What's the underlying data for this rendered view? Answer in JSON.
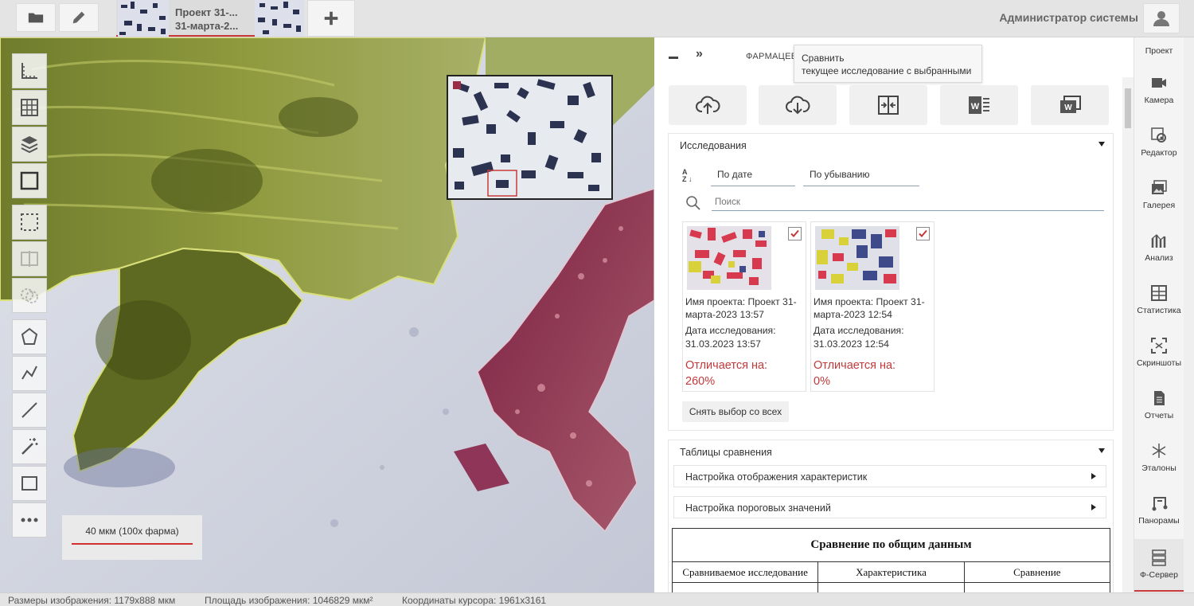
{
  "topbar": {
    "tab_title_line1": "Проект 31-...",
    "tab_title_line2": "31-марта-2...",
    "user_name": "Администратор системы"
  },
  "viewport": {
    "scale_label": "40 мкм (100х фарма)"
  },
  "panel": {
    "title": "ФАРМАЦЕВТИЧЕСКИЙ СЕРВЕР",
    "expand_glyph": "»",
    "tooltip": {
      "line1": "Сравнить",
      "line2": "текущее исследование с выбранными"
    },
    "studies": {
      "title": "Исследования",
      "sort_field": "По дате",
      "sort_order": "По убыванию",
      "search_placeholder": "Поиск",
      "cards": [
        {
          "project": "Имя проекта: Проект 31-марта-2023 13:57",
          "date_label": "Дата исследования:",
          "date": "31.03.2023 13:57",
          "diff_label": "Отличается на:",
          "diff_value": "260%",
          "checked": true
        },
        {
          "project": "Имя проекта: Проект 31-марта-2023 12:54",
          "date_label": "Дата исследования:",
          "date": "31.03.2023 12:54",
          "diff_label": "Отличается на:",
          "diff_value": "0%",
          "checked": true
        }
      ],
      "deselect_label": "Снять выбор со всех"
    },
    "comparison": {
      "title": "Таблицы сравнения",
      "display_settings": "Настройка отображения характеристик",
      "threshold_settings": "Настройка пороговых значений",
      "table_title": "Сравнение по общим данным",
      "columns": [
        "Сравниваемое исследование",
        "Характеристика",
        "Сравнение"
      ]
    }
  },
  "rightnav": {
    "items": [
      {
        "label": "Проект",
        "icon": "project-icon"
      },
      {
        "label": "Камера",
        "icon": "camera-icon"
      },
      {
        "label": "Редактор",
        "icon": "editor-icon"
      },
      {
        "label": "Галерея",
        "icon": "gallery-icon"
      },
      {
        "label": "Анализ",
        "icon": "analysis-icon"
      },
      {
        "label": "Статистика",
        "icon": "statistics-icon"
      },
      {
        "label": "Скриншоты",
        "icon": "screenshot-icon"
      },
      {
        "label": "Отчеты",
        "icon": "report-icon"
      },
      {
        "label": "Эталоны",
        "icon": "standards-icon"
      },
      {
        "label": "Панорамы",
        "icon": "panorama-icon"
      },
      {
        "label": "Ф-Сервер",
        "icon": "server-icon"
      }
    ],
    "active": "Ф-Сервер"
  },
  "statusbar": {
    "image_size": "Размеры изображения: 1179x888 мкм",
    "image_area": "Площадь изображения: 1046829 мкм²",
    "cursor": "Координаты курсора: 1961x3161"
  },
  "colors": {
    "accent_red": "#c83a3a",
    "diff_red": "#c0393b"
  }
}
